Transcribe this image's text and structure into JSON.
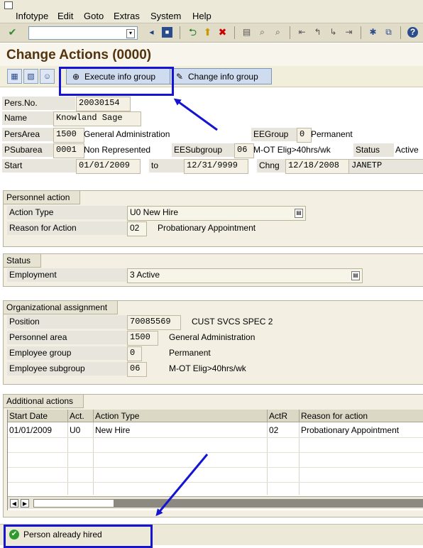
{
  "menubar": {
    "items": [
      "Infotype",
      "Edit",
      "Goto",
      "Extras",
      "System",
      "Help"
    ]
  },
  "toolbar": {
    "icons": [
      "enter-icon",
      "back-icon",
      "exit-icon",
      "cancel-icon",
      "print-icon",
      "find-icon",
      "find-next-icon",
      "first-page-icon",
      "previous-page-icon",
      "next-page-icon",
      "last-page-icon",
      "create-session-icon",
      "shortcut-icon",
      "help-icon"
    ]
  },
  "title": "Change Actions (0000)",
  "app_toolbar": {
    "execute_label": "Execute info group",
    "change_label": "Change info group"
  },
  "header": {
    "pers_no_label": "Pers.No.",
    "pers_no": "20030154",
    "name_label": "Name",
    "name": "Knowland Sage",
    "persarea_label": "PersArea",
    "persarea_code": "1500",
    "persarea_text": "General Administration",
    "eegroup_label": "EEGroup",
    "eegroup_code": "0",
    "eegroup_text": "Permanent",
    "psubarea_label": "PSubarea",
    "psubarea_code": "0001",
    "psubarea_text": "Non Represented",
    "eesubgroup_label": "EESubgroup",
    "eesubgroup_code": "06",
    "eesubgroup_text": "M-OT Elig>40hrs/wk",
    "status_label": "Status",
    "status_value": "Active",
    "start_label": "Start",
    "start_date": "01/01/2009",
    "to_label": "to",
    "end_date": "12/31/9999",
    "chng_label": "Chng",
    "chng_date": "12/18/2008",
    "chng_user": "JANETP"
  },
  "personnel_action": {
    "title": "Personnel action",
    "action_type_label": "Action Type",
    "action_type_value": "U0 New Hire",
    "reason_label": "Reason for Action",
    "reason_code": "02",
    "reason_text": "Probationary Appointment"
  },
  "status_group": {
    "title": "Status",
    "employment_label": "Employment",
    "employment_value": "3 Active"
  },
  "org_assignment": {
    "title": "Organizational assignment",
    "position_label": "Position",
    "position_code": "70085569",
    "position_text": "CUST SVCS SPEC 2",
    "personnel_area_label": "Personnel area",
    "personnel_area_code": "1500",
    "personnel_area_text": "General Administration",
    "employee_group_label": "Employee group",
    "employee_group_code": "0",
    "employee_group_text": "Permanent",
    "employee_subgroup_label": "Employee subgroup",
    "employee_subgroup_code": "06",
    "employee_subgroup_text": "M-OT Elig>40hrs/wk"
  },
  "additional_actions": {
    "title": "Additional actions",
    "columns": [
      "Start Date",
      "Act.",
      "Action Type",
      "ActR",
      "Reason for action"
    ],
    "rows": [
      [
        "01/01/2009",
        "U0",
        "New Hire",
        "02",
        "Probationary Appointment"
      ]
    ]
  },
  "statusbar": {
    "message": "Person already hired"
  },
  "colors": {
    "annotation_blue": "#1414d2",
    "title_brown": "#53340f",
    "success_green": "#2e9b2e"
  }
}
